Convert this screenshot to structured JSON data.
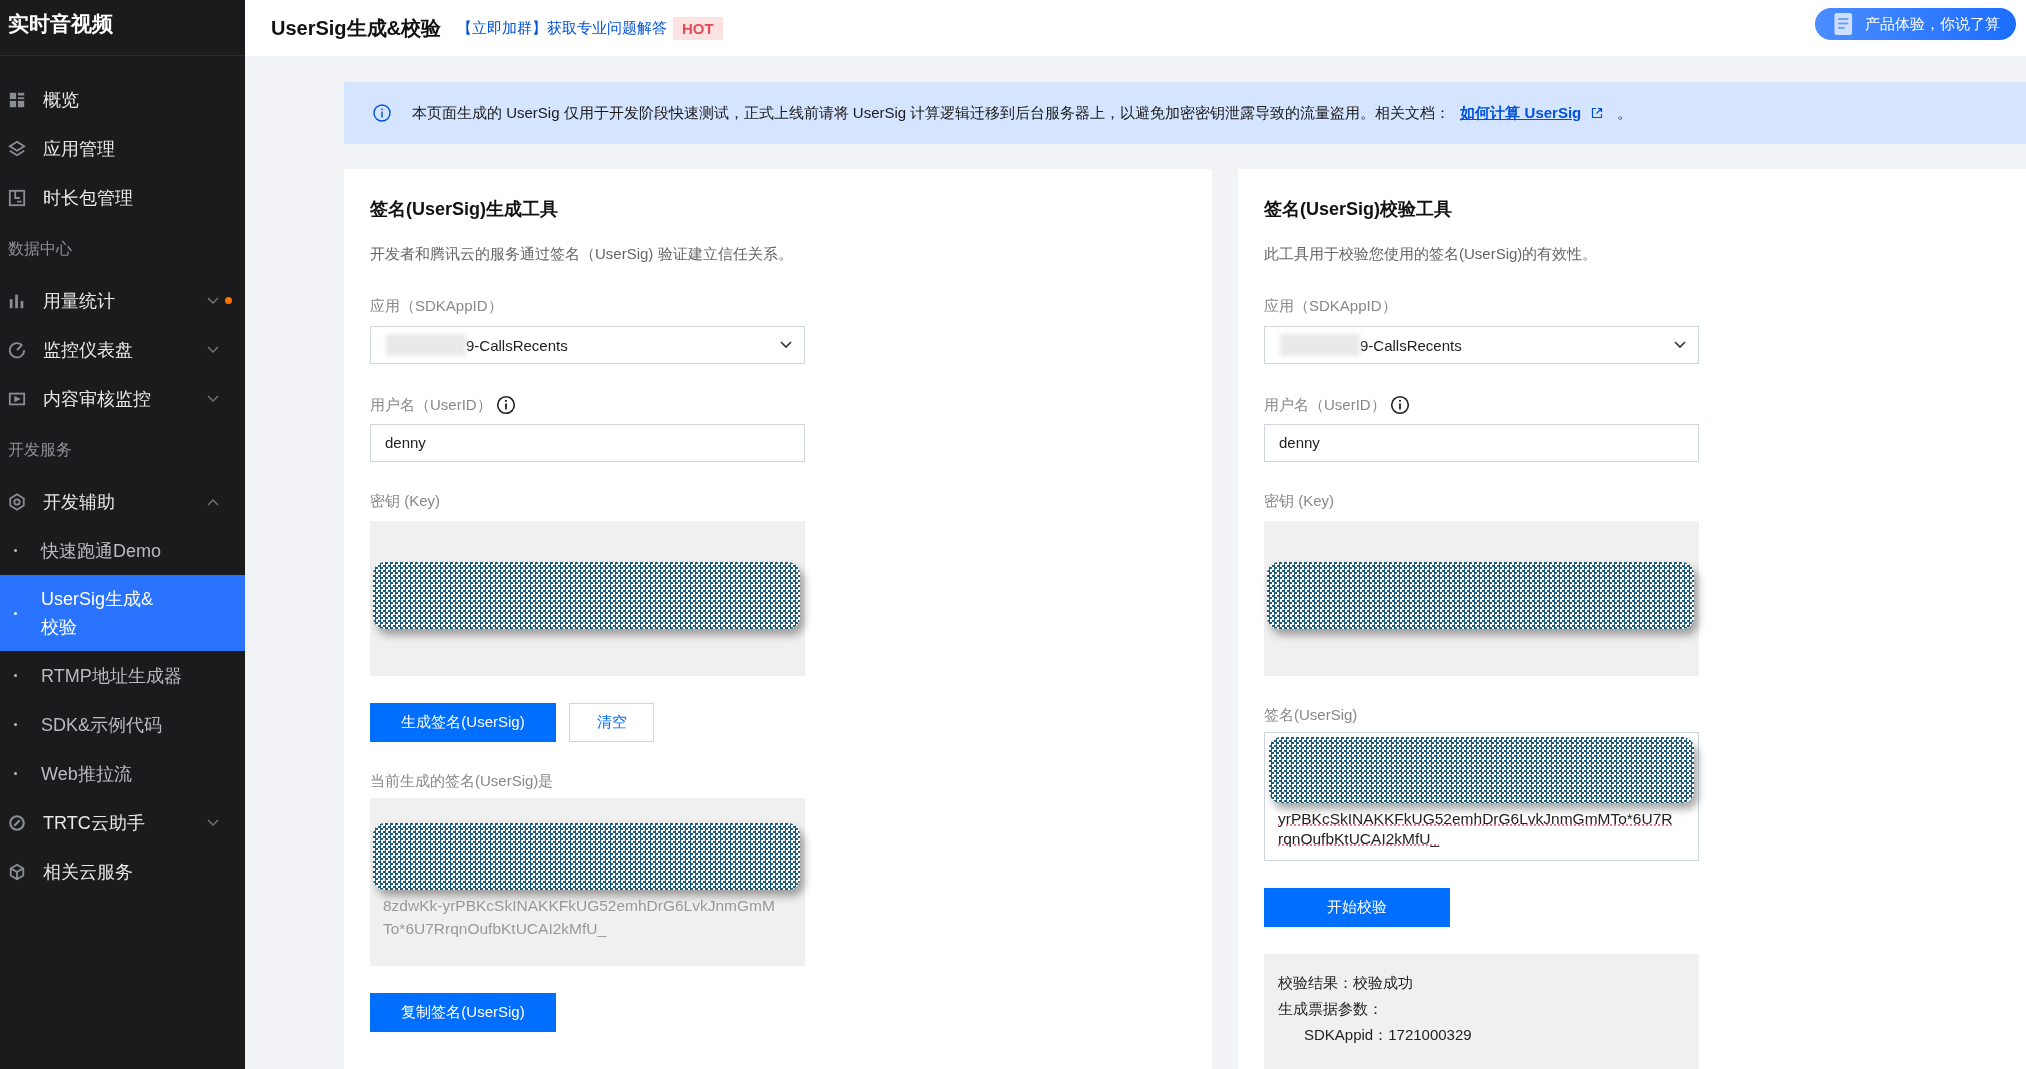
{
  "sidebar": {
    "title": "实时音视频",
    "items": [
      {
        "kind": "item",
        "label": "概览",
        "selected": false
      },
      {
        "kind": "item",
        "label": "应用管理",
        "selected": false
      },
      {
        "kind": "item",
        "label": "时长包管理",
        "selected": false
      },
      {
        "kind": "section",
        "label": "数据中心"
      },
      {
        "kind": "item",
        "label": "用量统计",
        "selected": false,
        "expanded": false,
        "dot": true
      },
      {
        "kind": "item",
        "label": "监控仪表盘",
        "selected": false,
        "expanded": false
      },
      {
        "kind": "item",
        "label": "内容审核监控",
        "selected": false,
        "expanded": false
      },
      {
        "kind": "section",
        "label": "开发服务"
      },
      {
        "kind": "item",
        "label": "开发辅助",
        "selected": false,
        "expanded": true,
        "children": [
          {
            "label": "快速跑通Demo",
            "selected": false
          },
          {
            "label": "UserSig生成&校验",
            "selected": true
          },
          {
            "label": "RTMP地址生成器",
            "selected": false
          },
          {
            "label": "SDK&示例代码",
            "selected": false
          },
          {
            "label": "Web推拉流",
            "selected": false
          }
        ]
      },
      {
        "kind": "item",
        "label": "TRTC云助手",
        "selected": false,
        "expanded": false
      },
      {
        "kind": "item",
        "label": "相关云服务",
        "selected": false
      }
    ]
  },
  "header": {
    "title": "UserSig生成&校验",
    "link": "【立即加群】获取专业问题解答",
    "badge": "HOT",
    "feedback": "产品体验，你说了算"
  },
  "notice": {
    "text": "本页面生成的 UserSig 仅用于开发阶段快速测试，正式上线前请将 UserSig 计算逻辑迁移到后台服务器上，以避免加密密钥泄露导致的流量盗用。相关文档：",
    "link": "如何计算 UserSig",
    "end": "。"
  },
  "generator": {
    "title": "签名(UserSig)生成工具",
    "description": "开发者和腾讯云的服务通过签名（UserSig) 验证建立信任关系。",
    "app_label": "应用（SDKAppID）",
    "app_value": "9-CallsRecents",
    "user_label": "用户名（UserID）",
    "user_value": "denny",
    "key_label": "密钥 (Key)",
    "buttons": [
      {
        "label": "生成签名(UserSig)",
        "kind": "primary"
      },
      {
        "label": "清空",
        "kind": "secondary"
      }
    ],
    "output_label": "当前生成的签名(UserSig)是",
    "output_lines": [
      "8zdwKk-yrPBKcSkINAKKFkUG52emhDrG6LvkJnmGmM",
      "To*6U7RrqnOufbKtUCAI2kMfU_"
    ],
    "copy_button": "复制签名(UserSig)"
  },
  "verifier": {
    "title": "签名(UserSig)校验工具",
    "description": "此工具用于校验您使用的签名(UserSig)的有效性。",
    "app_label": "应用（SDKAppID）",
    "app_value": "9-CallsRecents",
    "user_label": "用户名（UserID）",
    "user_value": "denny",
    "key_label": "密钥 (Key)",
    "sig_label": "签名(UserSig)",
    "sig_lines": [
      "yrPBKcSkINAKKFkUG52emhDrG6LvkJnmGmMTo*6U7R",
      "rqnOufbKtUCAI2kMfU_"
    ],
    "verify_button": "开始校验",
    "result": {
      "status_label": "校验结果：",
      "status_value": "校验成功",
      "params_label": "生成票据参数：",
      "params": [
        "SDKAppid：1721000329"
      ]
    }
  }
}
